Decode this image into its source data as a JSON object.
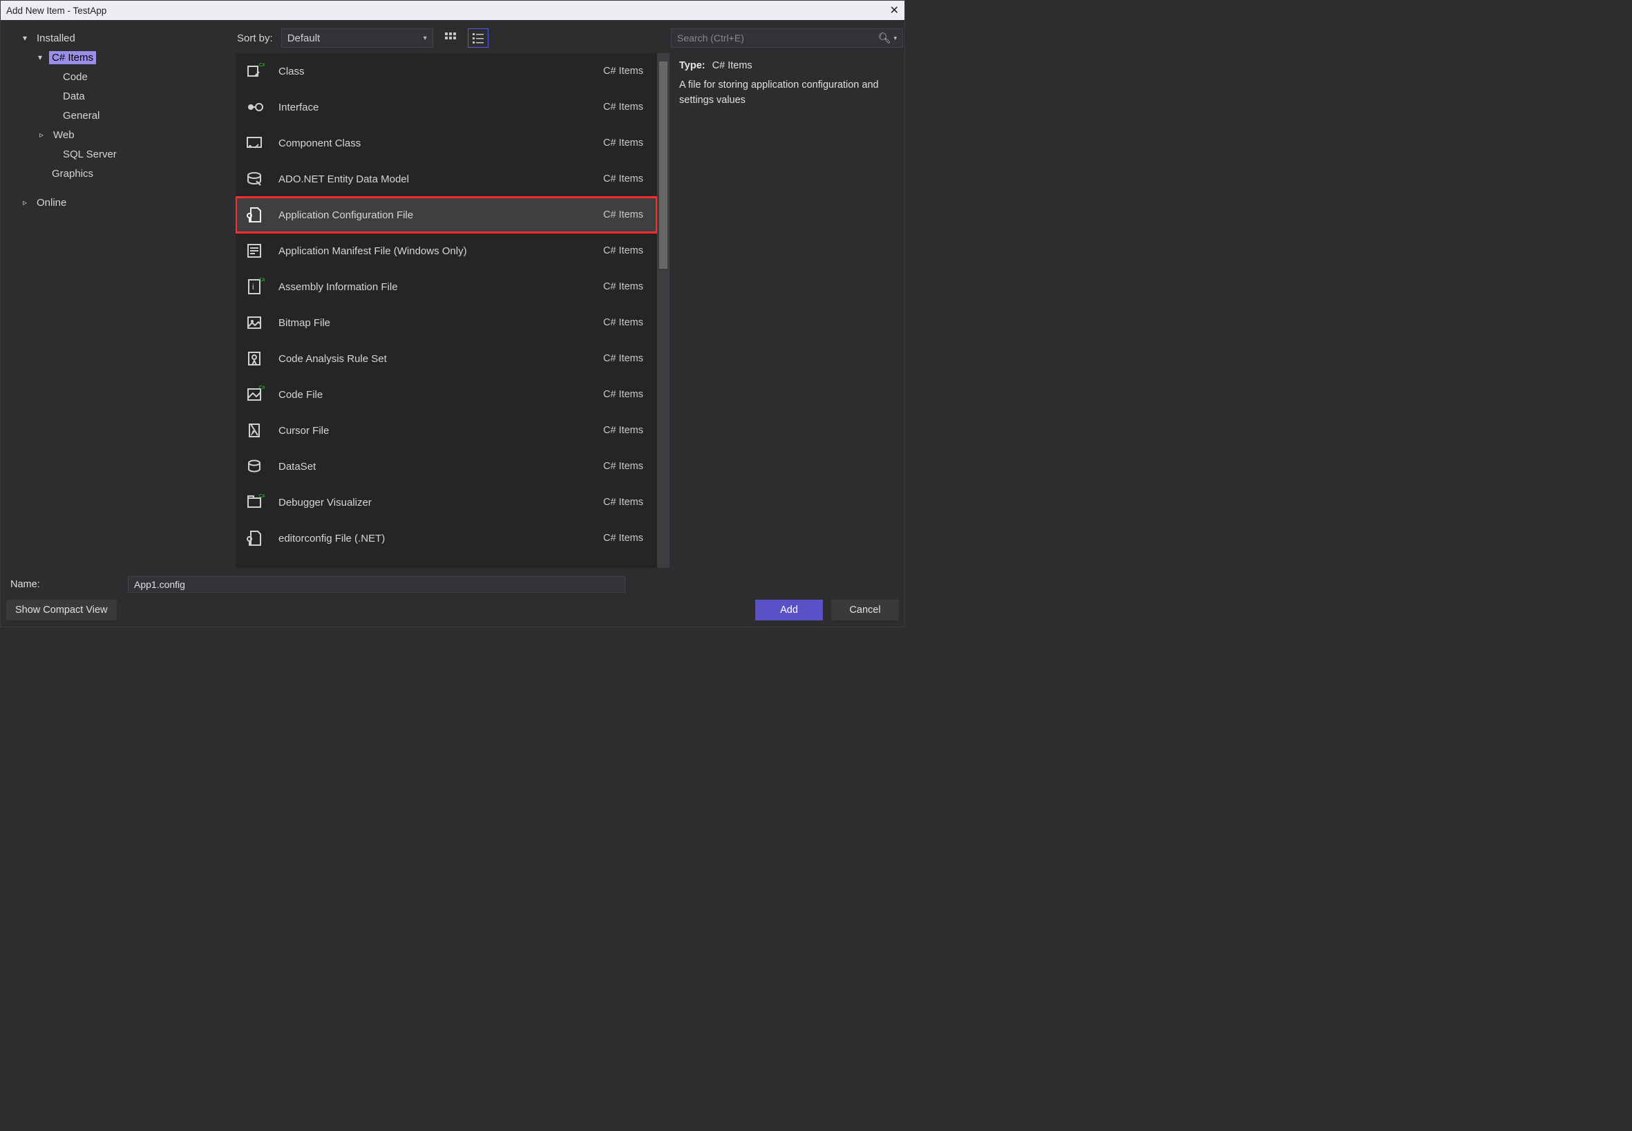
{
  "window": {
    "title": "Add New Item - TestApp"
  },
  "tree": {
    "installed_label": "Installed",
    "online_label": "Online",
    "csharp_items_label": "C# Items",
    "children": {
      "code": "Code",
      "data": "Data",
      "general": "General",
      "web": "Web",
      "sql": "SQL Server"
    },
    "graphics_label": "Graphics"
  },
  "sort": {
    "label": "Sort by:",
    "value": "Default"
  },
  "search": {
    "placeholder": "Search (Ctrl+E)"
  },
  "templates": [
    {
      "name": "Class",
      "category": "C# Items"
    },
    {
      "name": "Interface",
      "category": "C# Items"
    },
    {
      "name": "Component Class",
      "category": "C# Items"
    },
    {
      "name": "ADO.NET Entity Data Model",
      "category": "C# Items"
    },
    {
      "name": "Application Configuration File",
      "category": "C# Items"
    },
    {
      "name": "Application Manifest File (Windows Only)",
      "category": "C# Items"
    },
    {
      "name": "Assembly Information File",
      "category": "C# Items"
    },
    {
      "name": "Bitmap File",
      "category": "C# Items"
    },
    {
      "name": "Code Analysis Rule Set",
      "category": "C# Items"
    },
    {
      "name": "Code File",
      "category": "C# Items"
    },
    {
      "name": "Cursor File",
      "category": "C# Items"
    },
    {
      "name": "DataSet",
      "category": "C# Items"
    },
    {
      "name": "Debugger Visualizer",
      "category": "C# Items"
    },
    {
      "name": "editorconfig File (.NET)",
      "category": "C# Items"
    }
  ],
  "selected_index": 4,
  "details": {
    "type_label": "Type:",
    "type_value": "C# Items",
    "description": "A file for storing application configuration and settings values"
  },
  "name_field": {
    "label": "Name:",
    "value": "App1.config"
  },
  "buttons": {
    "compact": "Show Compact View",
    "add": "Add",
    "cancel": "Cancel"
  }
}
